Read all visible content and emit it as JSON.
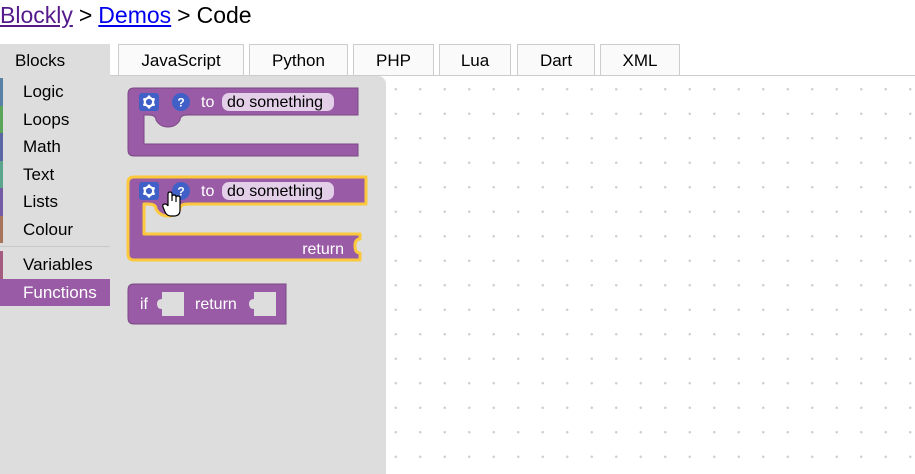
{
  "breadcrumb": {
    "root": "Blockly",
    "sep1": ">",
    "demos": "Demos",
    "sep2": ">",
    "current": "Code"
  },
  "tabs": [
    {
      "label": "JavaScript"
    },
    {
      "label": "Python"
    },
    {
      "label": "PHP"
    },
    {
      "label": "Lua"
    },
    {
      "label": "Dart"
    },
    {
      "label": "XML"
    }
  ],
  "toolbox": {
    "title": "Blocks",
    "categories": [
      {
        "label": "Logic",
        "color": "#5b80a5"
      },
      {
        "label": "Loops",
        "color": "#5ba55b"
      },
      {
        "label": "Math",
        "color": "#5b67a5"
      },
      {
        "label": "Text",
        "color": "#5ba58c"
      },
      {
        "label": "Lists",
        "color": "#745ba5"
      },
      {
        "label": "Colour",
        "color": "#a5745b"
      },
      {
        "label": "Variables",
        "color": "#a55b80"
      },
      {
        "label": "Functions",
        "color": "#995ba5",
        "selected": true
      }
    ]
  },
  "flyout": {
    "block_color": "#995ba5",
    "highlight_color": "#fcc83c",
    "proc_no_return": {
      "to": "to",
      "name": "do something"
    },
    "proc_return": {
      "to": "to",
      "name": "do something",
      "return": "return"
    },
    "if_return": {
      "if": "if",
      "return": "return"
    },
    "icons": {
      "gear": "gear-icon",
      "help": "?"
    }
  }
}
